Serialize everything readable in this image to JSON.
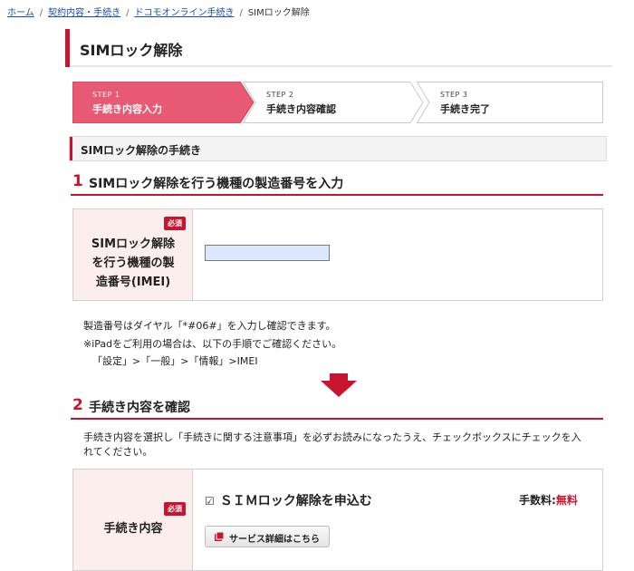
{
  "breadcrumb": {
    "items": [
      "ホーム",
      "契約内容・手続き",
      "ドコモオンライン手続き"
    ],
    "current": "SIMロック解除",
    "separator": "/"
  },
  "page_title": "SIMロック解除",
  "steps": [
    {
      "label": "STEP 1",
      "name": "手続き内容入力",
      "active": true
    },
    {
      "label": "STEP 2",
      "name": "手続き内容確認",
      "active": false
    },
    {
      "label": "STEP 3",
      "name": "手続き完了",
      "active": false
    }
  ],
  "subheading": "SIMロック解除の手続き",
  "section1": {
    "number": "1",
    "title": "SIMロック解除を行う機種の製造番号を入力",
    "required_badge": "必須",
    "field_label_lines": [
      "SIMロック解除",
      "を行う機種の製",
      "造番号(IMEI)"
    ],
    "imei_value": "",
    "notes": [
      "製造番号はダイヤル「*#06#」を入力し確認できます。",
      "※iPadをご利用の場合は、以下の手順でご確認ください。",
      "「設定」>「一般」>「情報」>IMEI"
    ]
  },
  "section2": {
    "number": "2",
    "title": "手続き内容を確認",
    "description": "手続き内容を選択し「手続きに関する注意事項」を必ずお読みになったうえ、チェックボックスにチェックを入れてください。",
    "required_badge": "必須",
    "field_label": "手続き内容",
    "checkbox_glyph": "☑",
    "checkbox_label": "ＳＩＭロック解除を申込む",
    "fee_label": "手数料:",
    "fee_value": "無料",
    "detail_button": "サービス詳細はこちら"
  },
  "colors": {
    "accent": "#c8142f",
    "link": "#1a4fa3",
    "label_bg": "#fdeeee",
    "input_bg": "#dbe8fb"
  }
}
